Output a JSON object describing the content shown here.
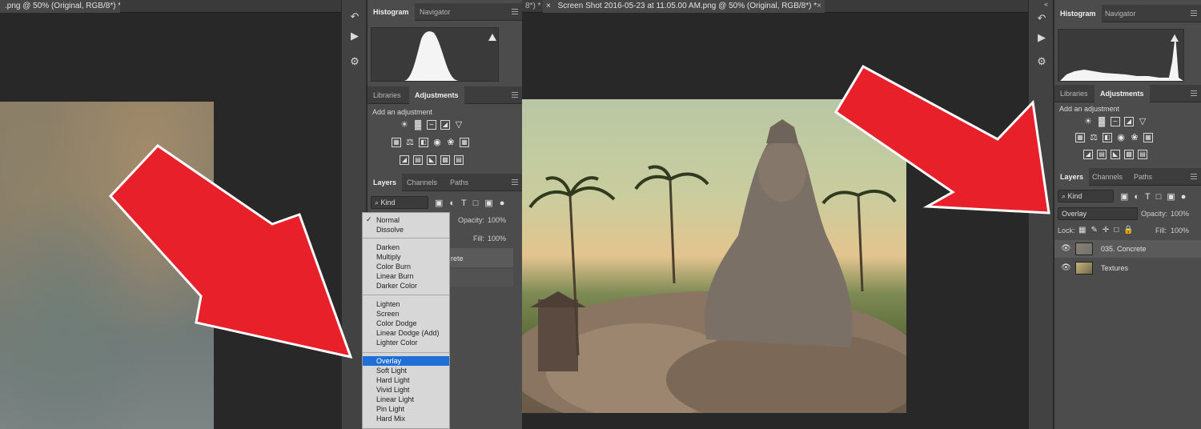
{
  "left_window": {
    "tab_title": ".png @ 50% (Original, RGB/8*) *",
    "tab_title_2": "8*) *",
    "panels": {
      "top_tabs": [
        "Histogram",
        "Navigator"
      ],
      "adj_tabs": [
        "Libraries",
        "Adjustments"
      ],
      "add_adjustment": "Add an adjustment",
      "layer_tabs": [
        "Layers",
        "Channels",
        "Paths"
      ],
      "kind_filter": "⌕ Kind",
      "opacity_label": "Opacity:",
      "opacity_value": "100%",
      "fill_label": "Fill:",
      "fill_value": "100%",
      "layer_name_partial": "rete"
    },
    "blend_menu": {
      "groups": [
        [
          "Normal",
          "Dissolve"
        ],
        [
          "Darken",
          "Multiply",
          "Color Burn",
          "Linear Burn",
          "Darker Color"
        ],
        [
          "Lighten",
          "Screen",
          "Color Dodge",
          "Linear Dodge (Add)",
          "Lighter Color"
        ],
        [
          "Overlay",
          "Soft Light",
          "Hard Light",
          "Vivid Light",
          "Linear Light",
          "Pin Light",
          "Hard Mix"
        ]
      ],
      "checked": "Normal",
      "highlighted": "Overlay",
      "check_mark": "✓"
    }
  },
  "right_window": {
    "tab_close": "×",
    "tab_title": "Screen Shot 2016-05-23 at 11.05.00 AM.png @ 50% (Original, RGB/8*) *",
    "tab_close_2": "×",
    "collapse_glyph": "«",
    "panels": {
      "top_tabs": [
        "Histogram",
        "Navigator"
      ],
      "adj_tabs": [
        "Libraries",
        "Adjustments"
      ],
      "add_adjustment": "Add an adjustment",
      "layer_tabs": [
        "Layers",
        "Channels",
        "Paths"
      ],
      "kind_filter": "⌕ Kind",
      "blend_mode": "Overlay",
      "opacity_label": "Opacity:",
      "opacity_value": "100%",
      "lock_label": "Lock:",
      "fill_label": "Fill:",
      "fill_value": "100%",
      "layers": [
        {
          "name": "035. Concrete"
        },
        {
          "name": "Textures"
        }
      ]
    }
  },
  "adjustment_icons": {
    "row1": [
      "brightness-icon",
      "levels-icon",
      "curves-icon",
      "exposure-icon",
      "gradient-triangle-icon"
    ],
    "row2": [
      "vibrance-icon",
      "balance-icon",
      "black-white-icon",
      "photo-filter-icon",
      "channel-mixer-icon",
      "color-lookup-icon"
    ],
    "row3": [
      "invert-icon",
      "posterize-icon",
      "threshold-icon",
      "selective-color-icon",
      "gradient-map-icon"
    ]
  },
  "colors": {
    "arrow": "#e8202a",
    "selection": "#1f6fd6",
    "panel_bg": "#4c4c4c"
  }
}
